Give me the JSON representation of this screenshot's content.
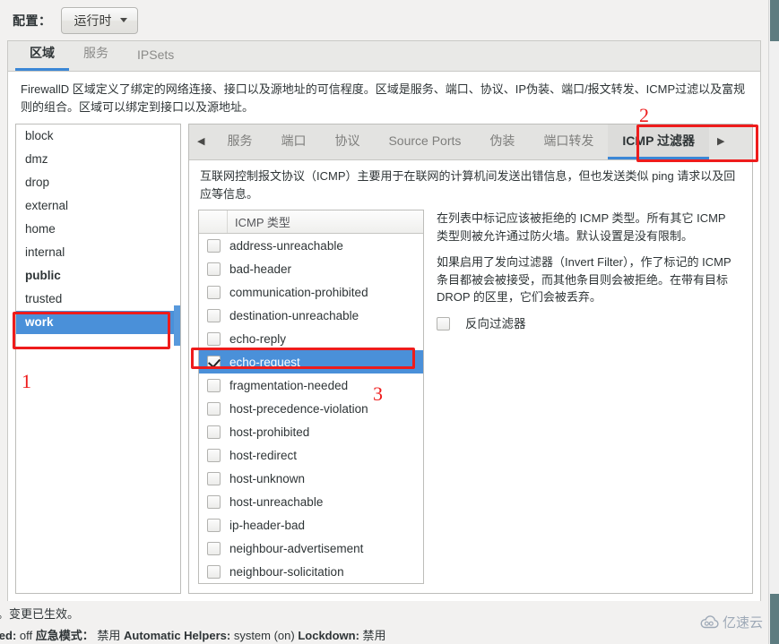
{
  "config": {
    "label": "配置：",
    "selected": "运行时",
    "caret_icon": "chevron-down-icon"
  },
  "tabs": [
    {
      "label": "区域",
      "active": true
    },
    {
      "label": "服务",
      "active": false
    },
    {
      "label": "IPSets",
      "active": false
    }
  ],
  "description": "FirewallD 区域定义了绑定的网络连接、接口以及源地址的可信程度。区域是服务、端口、协议、IP伪装、端口/报文转发、ICMP过滤以及富规则的组合。区域可以绑定到接口以及源地址。",
  "zones": [
    {
      "name": "block",
      "style": "normal"
    },
    {
      "name": "dmz",
      "style": "normal"
    },
    {
      "name": "drop",
      "style": "normal"
    },
    {
      "name": "external",
      "style": "normal"
    },
    {
      "name": "home",
      "style": "normal"
    },
    {
      "name": "internal",
      "style": "normal"
    },
    {
      "name": "public",
      "style": "bold"
    },
    {
      "name": "trusted",
      "style": "normal"
    },
    {
      "name": "work",
      "style": "selected"
    }
  ],
  "subtabs": {
    "prev_arrow": "◀",
    "next_arrow": "▶",
    "items": [
      {
        "label": "服务",
        "active": false
      },
      {
        "label": "端口",
        "active": false
      },
      {
        "label": "协议",
        "active": false
      },
      {
        "label": "Source Ports",
        "active": false
      },
      {
        "label": "伪装",
        "active": false
      },
      {
        "label": "端口转发",
        "active": false
      },
      {
        "label": "ICMP 过滤器",
        "active": true
      }
    ]
  },
  "icmp_panel": {
    "description": "互联网控制报文协议（ICMP）主要用于在联网的计算机间发送出错信息，但也发送类似 ping 请求以及回应等信息。",
    "table_header": "ICMP 类型",
    "rows": [
      {
        "label": "address-unreachable",
        "checked": false,
        "selected": false
      },
      {
        "label": "bad-header",
        "checked": false,
        "selected": false
      },
      {
        "label": "communication-prohibited",
        "checked": false,
        "selected": false
      },
      {
        "label": "destination-unreachable",
        "checked": false,
        "selected": false
      },
      {
        "label": "echo-reply",
        "checked": false,
        "selected": false
      },
      {
        "label": "echo-request",
        "checked": true,
        "selected": true
      },
      {
        "label": "fragmentation-needed",
        "checked": false,
        "selected": false
      },
      {
        "label": "host-precedence-violation",
        "checked": false,
        "selected": false
      },
      {
        "label": "host-prohibited",
        "checked": false,
        "selected": false
      },
      {
        "label": "host-redirect",
        "checked": false,
        "selected": false
      },
      {
        "label": "host-unknown",
        "checked": false,
        "selected": false
      },
      {
        "label": "host-unreachable",
        "checked": false,
        "selected": false
      },
      {
        "label": "ip-header-bad",
        "checked": false,
        "selected": false
      },
      {
        "label": "neighbour-advertisement",
        "checked": false,
        "selected": false
      },
      {
        "label": "neighbour-solicitation",
        "checked": false,
        "selected": false
      }
    ],
    "note_paragraph_1": "在列表中标记应该被拒绝的 ICMP 类型。所有其它 ICMP 类型则被允许通过防火墙。默认设置是没有限制。",
    "note_paragraph_2": "如果启用了发向过滤器（Invert Filter），作了标记的 ICMP 条目都被会被接受，而其他条目则会被拒绝。在带有目标 DROP 的区里，它们会被丢弃。",
    "invert_filter_label": "反向过滤器",
    "invert_filter_checked": false
  },
  "statusbar": {
    "line1": "接。变更已生效。",
    "line2_segments": [
      {
        "text": "enied:",
        "bold": true
      },
      {
        "text": " off  ",
        "bold": false
      },
      {
        "text": "应急模式：",
        "bold": true
      },
      {
        "text": " 禁用  ",
        "bold": false
      },
      {
        "text": "Automatic Helpers:",
        "bold": true
      },
      {
        "text": " system (on)  ",
        "bold": false
      },
      {
        "text": "Lockdown:",
        "bold": true
      },
      {
        "text": " 禁用",
        "bold": false
      }
    ]
  },
  "annotations": [
    {
      "number": "1",
      "target": "zone-work-row"
    },
    {
      "number": "2",
      "target": "icmp-filter-subtab"
    },
    {
      "number": "3",
      "target": "echo-request-row"
    }
  ],
  "watermark": {
    "text": "亿速云",
    "icon": "cloud-icon"
  },
  "colors": {
    "accent_blue": "#3b87d6",
    "selection_blue": "#4a90d9",
    "annotation_red": "#ee1c1c",
    "panel_bg": "#f2f1f0"
  }
}
